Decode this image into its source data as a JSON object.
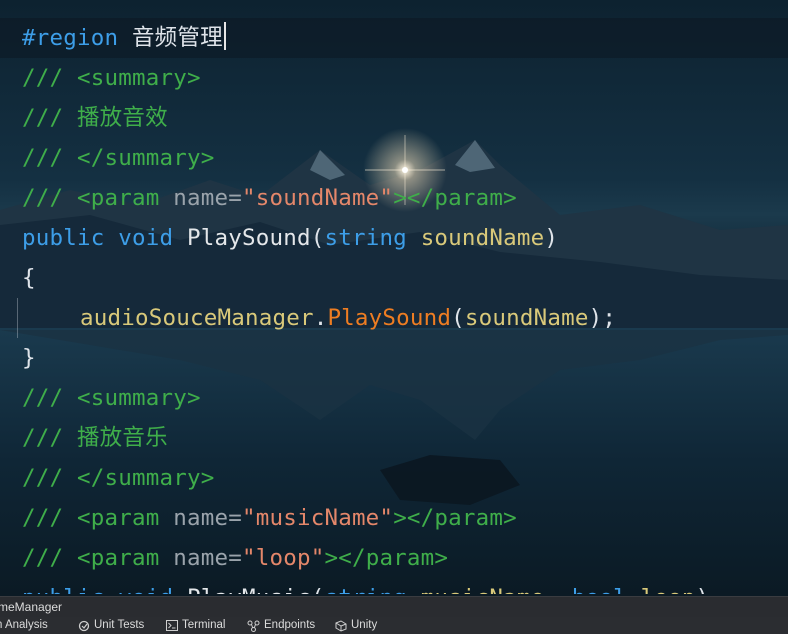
{
  "code_lines": [
    {
      "tokens": [
        {
          "t": "#region",
          "c": "c-kw"
        },
        {
          "t": " 音频管理",
          "c": "c-pl"
        }
      ],
      "current": true,
      "caret": true
    },
    {
      "tokens": [
        {
          "t": "/// ",
          "c": "c-grn"
        },
        {
          "t": "<summary>",
          "c": "c-grn"
        }
      ]
    },
    {
      "tokens": [
        {
          "t": "/// 播放音效",
          "c": "c-grn"
        }
      ]
    },
    {
      "tokens": [
        {
          "t": "/// ",
          "c": "c-grn"
        },
        {
          "t": "</summary>",
          "c": "c-grn"
        }
      ]
    },
    {
      "tokens": [
        {
          "t": "/// ",
          "c": "c-grn"
        },
        {
          "t": "<param ",
          "c": "c-grn"
        },
        {
          "t": "name=",
          "c": "c-attr"
        },
        {
          "t": "\"soundName\"",
          "c": "c-str"
        },
        {
          "t": "></param>",
          "c": "c-grn"
        }
      ]
    },
    {
      "tokens": [
        {
          "t": "public",
          "c": "c-kw"
        },
        {
          "t": " ",
          "c": "c-pl"
        },
        {
          "t": "void",
          "c": "c-kw"
        },
        {
          "t": " ",
          "c": "c-pl"
        },
        {
          "t": "PlaySound",
          "c": "c-fn"
        },
        {
          "t": "(",
          "c": "c-pl"
        },
        {
          "t": "string",
          "c": "c-kw"
        },
        {
          "t": " ",
          "c": "c-pl"
        },
        {
          "t": "soundName",
          "c": "c-par"
        },
        {
          "t": ")",
          "c": "c-pl"
        }
      ]
    },
    {
      "tokens": [
        {
          "t": "{",
          "c": "c-pl"
        }
      ]
    },
    {
      "tokens": [
        {
          "t": "audioSouceManager",
          "c": "c-par"
        },
        {
          "t": ".",
          "c": "c-pl"
        },
        {
          "t": "PlaySound",
          "c": "c-call"
        },
        {
          "t": "(",
          "c": "c-pl"
        },
        {
          "t": "soundName",
          "c": "c-par"
        },
        {
          "t": ");",
          "c": "c-pl"
        }
      ],
      "indent": true
    },
    {
      "tokens": [
        {
          "t": "}",
          "c": "c-pl"
        }
      ]
    },
    {
      "tokens": [
        {
          "t": "/// ",
          "c": "c-grn"
        },
        {
          "t": "<summary>",
          "c": "c-grn"
        }
      ]
    },
    {
      "tokens": [
        {
          "t": "/// 播放音乐",
          "c": "c-grn"
        }
      ]
    },
    {
      "tokens": [
        {
          "t": "/// ",
          "c": "c-grn"
        },
        {
          "t": "</summary>",
          "c": "c-grn"
        }
      ]
    },
    {
      "tokens": [
        {
          "t": "/// ",
          "c": "c-grn"
        },
        {
          "t": "<param ",
          "c": "c-grn"
        },
        {
          "t": "name=",
          "c": "c-attr"
        },
        {
          "t": "\"musicName\"",
          "c": "c-str"
        },
        {
          "t": "></param>",
          "c": "c-grn"
        }
      ]
    },
    {
      "tokens": [
        {
          "t": "/// ",
          "c": "c-grn"
        },
        {
          "t": "<param ",
          "c": "c-grn"
        },
        {
          "t": "name=",
          "c": "c-attr"
        },
        {
          "t": "\"loop\"",
          "c": "c-str"
        },
        {
          "t": "></param>",
          "c": "c-grn"
        }
      ]
    },
    {
      "tokens": [
        {
          "t": "public",
          "c": "c-kw"
        },
        {
          "t": " ",
          "c": "c-pl"
        },
        {
          "t": "void",
          "c": "c-kw"
        },
        {
          "t": " ",
          "c": "c-pl"
        },
        {
          "t": "PlayMusic",
          "c": "c-fn"
        },
        {
          "t": "(",
          "c": "c-pl"
        },
        {
          "t": "string",
          "c": "c-kw"
        },
        {
          "t": " ",
          "c": "c-pl"
        },
        {
          "t": "musicName",
          "c": "c-par"
        },
        {
          "t": ", ",
          "c": "c-pl"
        },
        {
          "t": "bool",
          "c": "c-kw"
        },
        {
          "t": " ",
          "c": "c-pl"
        },
        {
          "t": "loop",
          "c": "c-par"
        },
        {
          "t": ")",
          "c": "c-pl"
        }
      ]
    }
  ],
  "status": {
    "file_label": "meManager"
  },
  "toolbar": [
    {
      "label": "n Analysis",
      "icon": "analysis-icon"
    },
    {
      "label": "Unit Tests",
      "icon": "unit-tests-icon"
    },
    {
      "label": "Terminal",
      "icon": "terminal-icon"
    },
    {
      "label": "Endpoints",
      "icon": "endpoints-icon"
    },
    {
      "label": "Unity",
      "icon": "unity-icon"
    }
  ],
  "colors": {
    "keyword": "#3d9ee8",
    "comment": "#3fae4a",
    "string": "#e4876a",
    "parameter": "#d9c97a",
    "method_call": "#ee7d22"
  }
}
